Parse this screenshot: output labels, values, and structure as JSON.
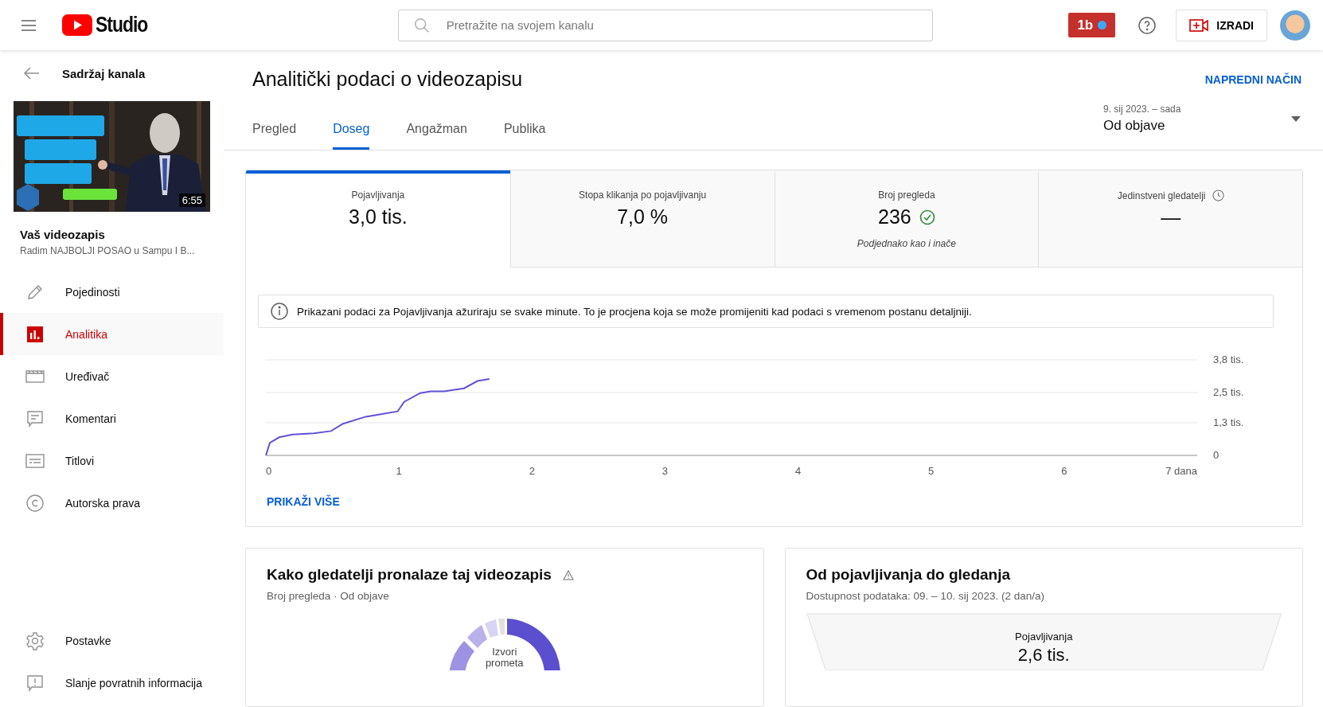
{
  "header": {
    "logo_text": "Studio",
    "search": {
      "placeholder": "Pretražite na svojem kanalu"
    },
    "extension_button": "1b",
    "create_button": "IZRADI"
  },
  "sidebar": {
    "back_label": "Sadržaj kanala",
    "video": {
      "kind": "picture",
      "duration": "6:55",
      "heading": "Vaš videozapis",
      "title": "Radim NAJBOLJI POSAO u Sampu I B..."
    },
    "items": [
      {
        "label": "Pojedinosti",
        "kind": "details",
        "selected": false
      },
      {
        "label": "Analitika",
        "kind": "analytics",
        "selected": true
      },
      {
        "label": "Uređivač",
        "kind": "editor",
        "selected": false
      },
      {
        "label": "Komentari",
        "kind": "comments",
        "selected": false
      },
      {
        "label": "Titlovi",
        "kind": "subtitles",
        "selected": false
      },
      {
        "label": "Autorska prava",
        "kind": "copyright",
        "selected": false
      }
    ],
    "footer_items": [
      {
        "label": "Postavke",
        "kind": "settings"
      },
      {
        "label": "Slanje povratnih informacija",
        "kind": "feedback"
      }
    ]
  },
  "page": {
    "title": "Analitički podaci o videozapisu",
    "advanced_link": "NAPREDNI NAČIN",
    "tabs": [
      {
        "label": "Pregled",
        "selected": false
      },
      {
        "label": "Doseg",
        "selected": true
      },
      {
        "label": "Angažman",
        "selected": false
      },
      {
        "label": "Publika",
        "selected": false
      }
    ],
    "date_range": {
      "range": "9. sij 2023. – sada",
      "label": "Od objave"
    }
  },
  "metrics": [
    {
      "label": "Pojavljivanja",
      "value": "3,0 tis.",
      "kind": "plain",
      "selected": true
    },
    {
      "label": "Stopa klikanja po pojavljivanju",
      "value": "7,0 %",
      "kind": "plain",
      "selected": false
    },
    {
      "label": "Broj pregleda",
      "value": "236",
      "kind": "verified",
      "note": "Podjednako kao i inače",
      "selected": false
    },
    {
      "label": "Jedinstveni gledatelji",
      "value": "—",
      "kind": "pending",
      "selected": false
    }
  ],
  "info_notice": "Prikazani podaci za Pojavljivanja ažuriraju se svake minute. To je procjena koja se može promijeniti kad podaci s vremenom postanu detaljniji.",
  "chart_data": {
    "type": "line",
    "x": [
      0,
      0.03,
      0.1,
      0.2,
      0.36,
      0.49,
      0.58,
      0.75,
      0.83,
      0.99,
      1.04,
      1.16,
      1.24,
      1.34,
      1.49,
      1.59,
      1.68
    ],
    "series": [
      {
        "color": "#6152d6",
        "values": [
          0,
          0.5,
          0.72,
          0.83,
          0.88,
          0.97,
          1.26,
          1.54,
          1.61,
          1.75,
          2.13,
          2.48,
          2.55,
          2.55,
          2.67,
          2.96,
          3.04
        ]
      }
    ],
    "xlim": [
      0,
      7
    ],
    "ylim": [
      0,
      3.8
    ],
    "xticks": [
      0,
      1,
      2,
      3,
      4,
      5,
      6,
      {
        "value": 7,
        "label": "7 dana"
      }
    ],
    "yticks": [
      {
        "value": 0,
        "label": "0"
      },
      {
        "value": 1.3,
        "label": "1,3 tis."
      },
      {
        "value": 2.5,
        "label": "2,5 tis."
      },
      {
        "value": 3.8,
        "label": "3,8 tis."
      }
    ]
  },
  "show_more": "PRIKAŽI VIŠE",
  "traffic_card": {
    "title": "Kako gledatelji pronalaze taj videozapis",
    "subtitle": "Broj pregleda · Od objave",
    "center_label": "Izvori prometa"
  },
  "funnel_card": {
    "title": "Od pojavljivanja do gledanja",
    "subtitle": "Dostupnost podataka: 09. – 10. sij 2023. (2 dan/a)",
    "stage_label": "Pojavljivanja",
    "stage_value": "2,6 tis."
  }
}
